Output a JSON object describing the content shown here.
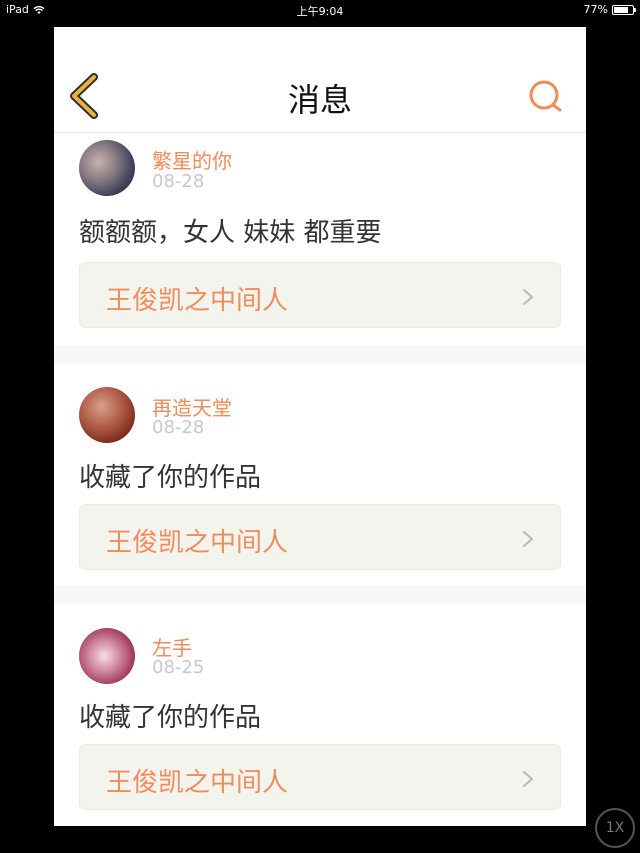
{
  "status_bar": {
    "device": "iPad",
    "time": "上午9:04",
    "battery_text": "77%",
    "battery_level": 0.77
  },
  "nav": {
    "title": "消息",
    "back_icon": "chevron-left-icon",
    "search_icon": "search-icon"
  },
  "colors": {
    "accent": "#f08c5a",
    "back_icon": "#e8b33c",
    "card_link_bg": "#f4f4ee"
  },
  "messages": [
    {
      "username": "繁星的你",
      "date": "08-28",
      "content": "额额额，女人 妹妹 都重要",
      "work_title": "王俊凯之中间人"
    },
    {
      "username": "再造天堂",
      "date": "08-28",
      "content": "收藏了你的作品",
      "work_title": "王俊凯之中间人"
    },
    {
      "username": "左手",
      "date": "08-25",
      "content": "收藏了你的作品",
      "work_title": "王俊凯之中间人"
    }
  ],
  "zoom_badge": "1X"
}
